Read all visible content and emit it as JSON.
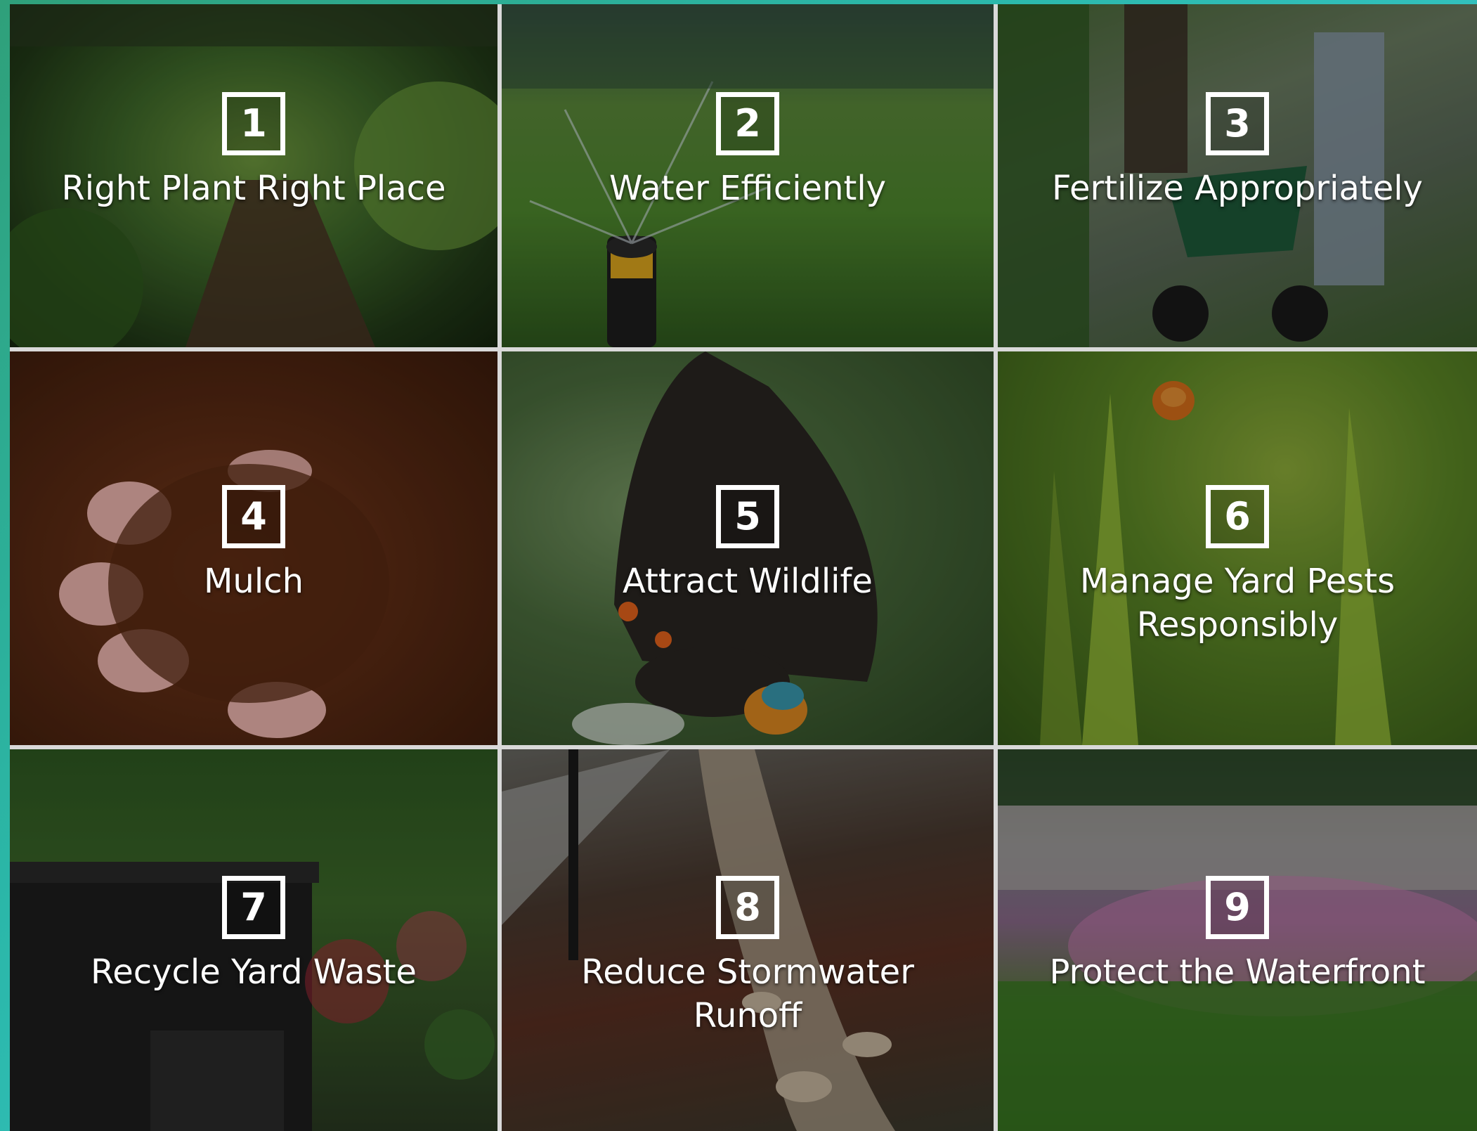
{
  "principles": [
    {
      "number": "1",
      "label": "Right Plant Right Place"
    },
    {
      "number": "2",
      "label": "Water Efficiently"
    },
    {
      "number": "3",
      "label": "Fertilize Appropriately"
    },
    {
      "number": "4",
      "label": "Mulch"
    },
    {
      "number": "5",
      "label": "Attract Wildlife"
    },
    {
      "number": "6",
      "label": "Manage Yard Pests Responsibly"
    },
    {
      "number": "7",
      "label": "Recycle Yard Waste"
    },
    {
      "number": "8",
      "label": "Reduce Stormwater Runoff"
    },
    {
      "number": "9",
      "label": "Protect the Waterfront"
    }
  ],
  "colors": {
    "page_background_start": "#2fa07a",
    "page_background_end": "#3fd3e3",
    "tile_divider": "#d9d9d9",
    "label_text": "#ffffff"
  }
}
